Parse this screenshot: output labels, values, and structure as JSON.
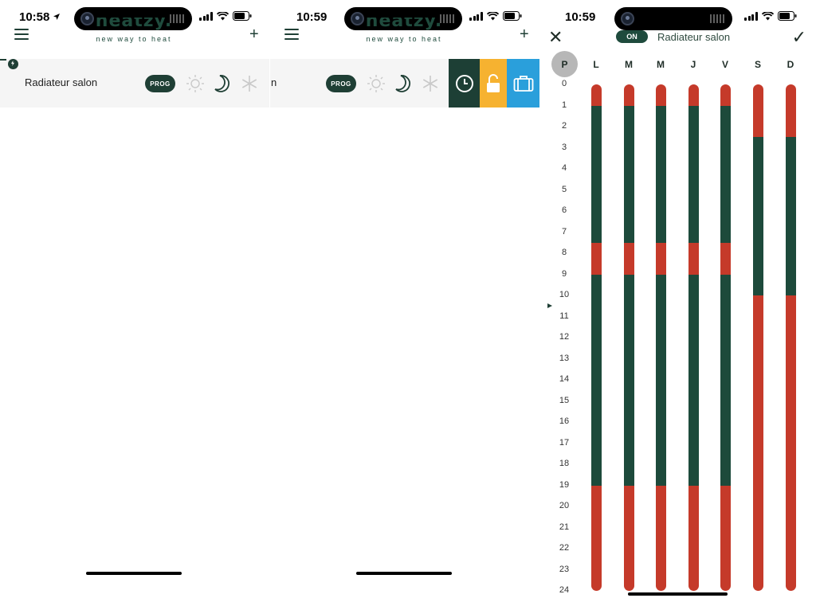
{
  "colors": {
    "comfort": "#c53a2a",
    "eco": "#1d4a3b",
    "clock_bg": "#1d3f35",
    "unlock_bg": "#f6b230",
    "vacation_bg": "#2a9fdb"
  },
  "screen1": {
    "status_time": "10:58",
    "logo_text": "heatzy.",
    "logo_tagline": "new way to heat",
    "device_name": "Radiateur salon",
    "prog_label": "PROG"
  },
  "screen2": {
    "status_time": "10:59",
    "logo_text": "heatzy.",
    "logo_tagline": "new way to heat",
    "device_name_partial": "n",
    "prog_label": "PROG",
    "swipe_actions": [
      {
        "name": "clock-action-button",
        "icon": "clock-icon"
      },
      {
        "name": "unlock-action-button",
        "icon": "unlock-icon"
      },
      {
        "name": "vacation-action-button",
        "icon": "suitcase-icon"
      }
    ]
  },
  "screen3": {
    "status_time": "10:59",
    "toggle_label": "ON",
    "title": "Radiateur salon",
    "p_label": "P",
    "days": [
      "L",
      "M",
      "M",
      "J",
      "V",
      "S",
      "D"
    ],
    "hours": [
      "0",
      "1",
      "2",
      "3",
      "4",
      "5",
      "6",
      "7",
      "8",
      "9",
      "10",
      "11",
      "12",
      "13",
      "14",
      "15",
      "16",
      "17",
      "18",
      "19",
      "20",
      "21",
      "22",
      "23",
      "24"
    ],
    "current_hour": 10.5,
    "schedule": [
      [
        {
          "from": 0,
          "to": 1,
          "mode": "comfort"
        },
        {
          "from": 1,
          "to": 7.5,
          "mode": "eco"
        },
        {
          "from": 7.5,
          "to": 9,
          "mode": "comfort"
        },
        {
          "from": 9,
          "to": 19,
          "mode": "eco"
        },
        {
          "from": 19,
          "to": 24,
          "mode": "comfort"
        }
      ],
      [
        {
          "from": 0,
          "to": 1,
          "mode": "comfort"
        },
        {
          "from": 1,
          "to": 7.5,
          "mode": "eco"
        },
        {
          "from": 7.5,
          "to": 9,
          "mode": "comfort"
        },
        {
          "from": 9,
          "to": 19,
          "mode": "eco"
        },
        {
          "from": 19,
          "to": 24,
          "mode": "comfort"
        }
      ],
      [
        {
          "from": 0,
          "to": 1,
          "mode": "comfort"
        },
        {
          "from": 1,
          "to": 7.5,
          "mode": "eco"
        },
        {
          "from": 7.5,
          "to": 9,
          "mode": "comfort"
        },
        {
          "from": 9,
          "to": 19,
          "mode": "eco"
        },
        {
          "from": 19,
          "to": 24,
          "mode": "comfort"
        }
      ],
      [
        {
          "from": 0,
          "to": 1,
          "mode": "comfort"
        },
        {
          "from": 1,
          "to": 7.5,
          "mode": "eco"
        },
        {
          "from": 7.5,
          "to": 9,
          "mode": "comfort"
        },
        {
          "from": 9,
          "to": 19,
          "mode": "eco"
        },
        {
          "from": 19,
          "to": 24,
          "mode": "comfort"
        }
      ],
      [
        {
          "from": 0,
          "to": 1,
          "mode": "comfort"
        },
        {
          "from": 1,
          "to": 7.5,
          "mode": "eco"
        },
        {
          "from": 7.5,
          "to": 9,
          "mode": "comfort"
        },
        {
          "from": 9,
          "to": 19,
          "mode": "eco"
        },
        {
          "from": 19,
          "to": 24,
          "mode": "comfort"
        }
      ],
      [
        {
          "from": 0,
          "to": 2.5,
          "mode": "comfort"
        },
        {
          "from": 2.5,
          "to": 10,
          "mode": "eco"
        },
        {
          "from": 10,
          "to": 24,
          "mode": "comfort"
        }
      ],
      [
        {
          "from": 0,
          "to": 2.5,
          "mode": "comfort"
        },
        {
          "from": 2.5,
          "to": 10,
          "mode": "eco"
        },
        {
          "from": 10,
          "to": 24,
          "mode": "comfort"
        }
      ]
    ]
  }
}
